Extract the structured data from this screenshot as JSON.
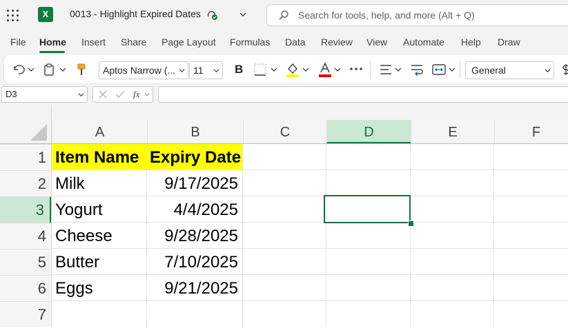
{
  "titlebar": {
    "doc_title": "0013 - Highlight Expired Dates",
    "search_placeholder": "Search for tools, help, and more (Alt + Q)"
  },
  "menu": {
    "tabs": [
      "File",
      "Home",
      "Insert",
      "Share",
      "Page Layout",
      "Formulas",
      "Data",
      "Review",
      "View",
      "Automate",
      "Help",
      "Draw"
    ],
    "active": "Home"
  },
  "ribbon": {
    "font_name": "Aptos Narrow (...",
    "font_size": "11",
    "bold_label": "B",
    "number_format": "General",
    "accent_color": "#107c41",
    "highlight_color": "#ffff00",
    "font_color": "#e00000"
  },
  "formula_bar": {
    "name_box": "D3",
    "fx_label": "fx",
    "formula": ""
  },
  "sheet": {
    "columns": [
      "A",
      "B",
      "C",
      "D",
      "E",
      "F"
    ],
    "rows": [
      "1",
      "2",
      "3",
      "4",
      "5",
      "6",
      "7"
    ],
    "selected_cell": "D3",
    "header_fill": "#ffff00",
    "cells": {
      "A1": "Item Name",
      "B1": "Expiry Date",
      "A2": "Milk",
      "B2": "9/17/2025",
      "A3": "Yogurt",
      "B3": "4/4/2025",
      "A4": "Cheese",
      "B4": "9/28/2025",
      "A5": "Butter",
      "B5": "7/10/2025",
      "A6": "Eggs",
      "B6": "9/21/2025"
    }
  }
}
